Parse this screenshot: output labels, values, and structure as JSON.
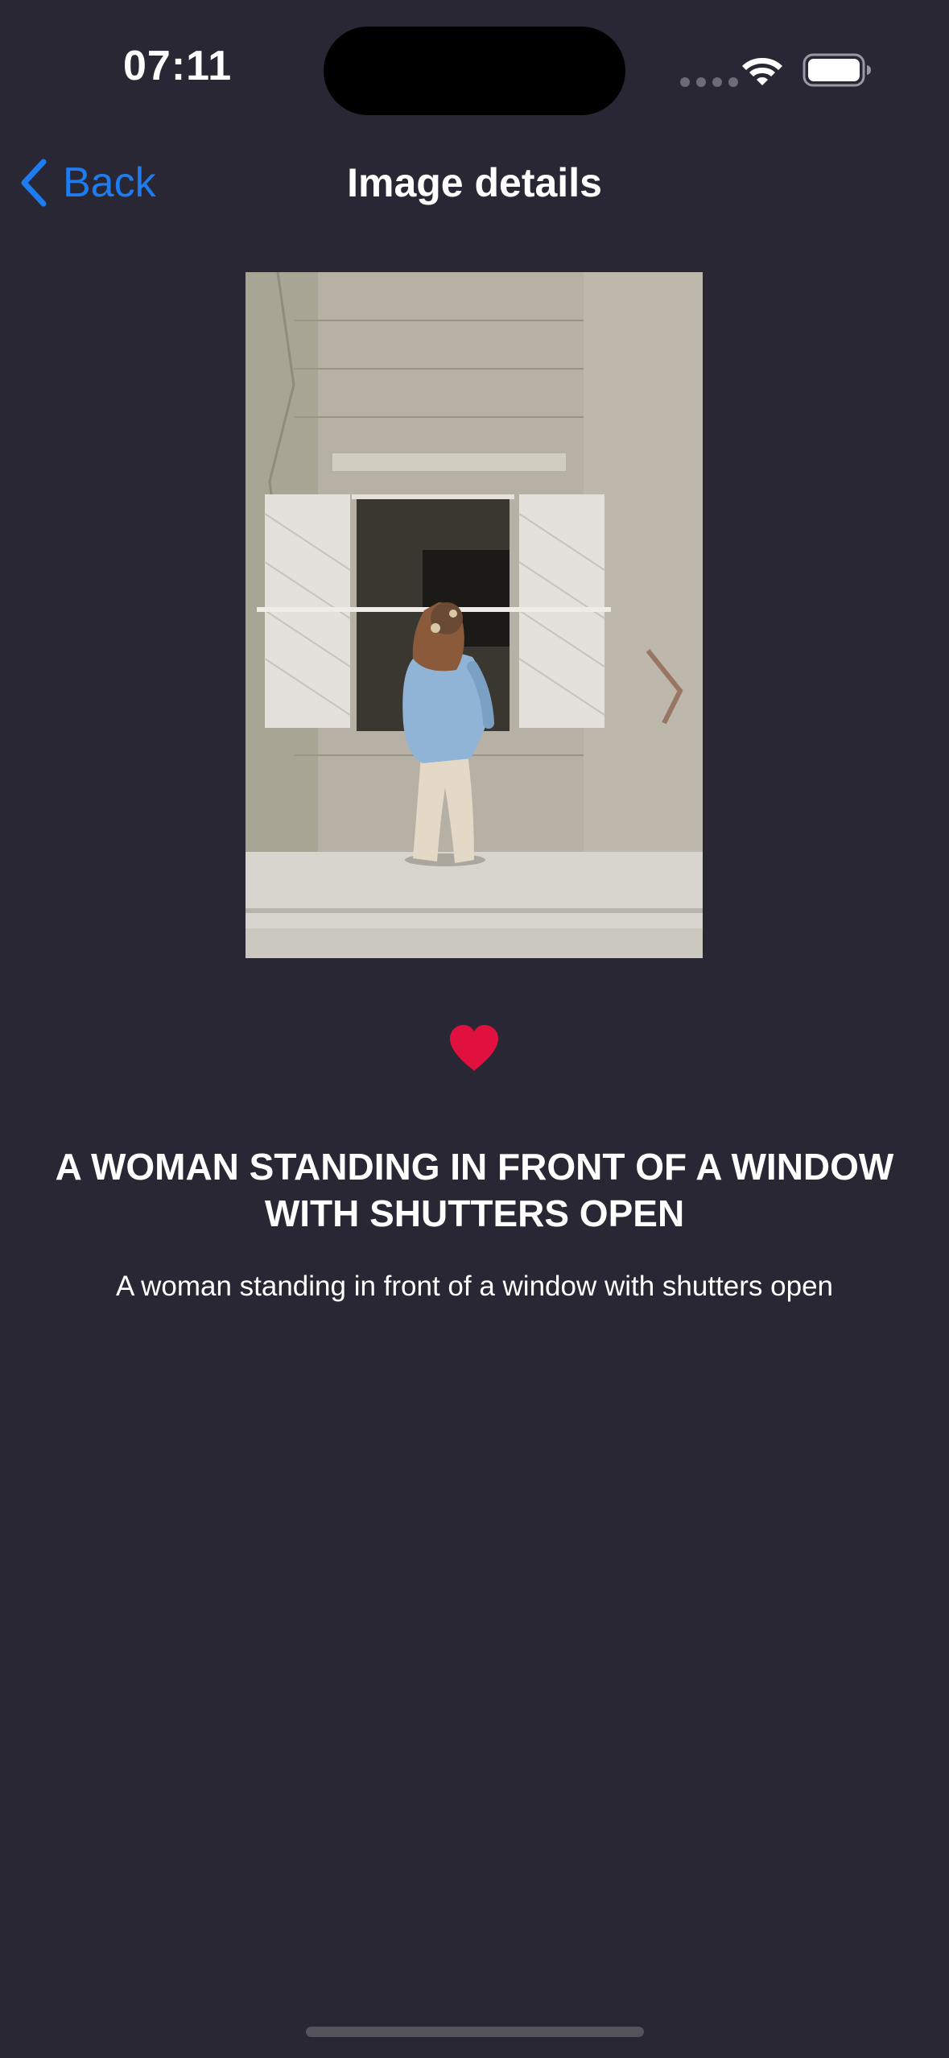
{
  "status_bar": {
    "time": "07:11",
    "wifi_icon": "wifi-icon",
    "battery_icon": "battery-full-icon"
  },
  "nav": {
    "back_label": "Back",
    "back_icon": "chevron-left-icon",
    "title": "Image details"
  },
  "image": {
    "alt": "A woman standing in front of a window with shutters open"
  },
  "favorite": {
    "icon": "heart-icon",
    "color": "#e0103f",
    "active": true
  },
  "details": {
    "headline": "A woman standing in front of a window with shutters open",
    "caption": "A woman standing in front of a window with shutters open"
  },
  "colors": {
    "background": "#292733",
    "accent": "#1e7cf1"
  }
}
